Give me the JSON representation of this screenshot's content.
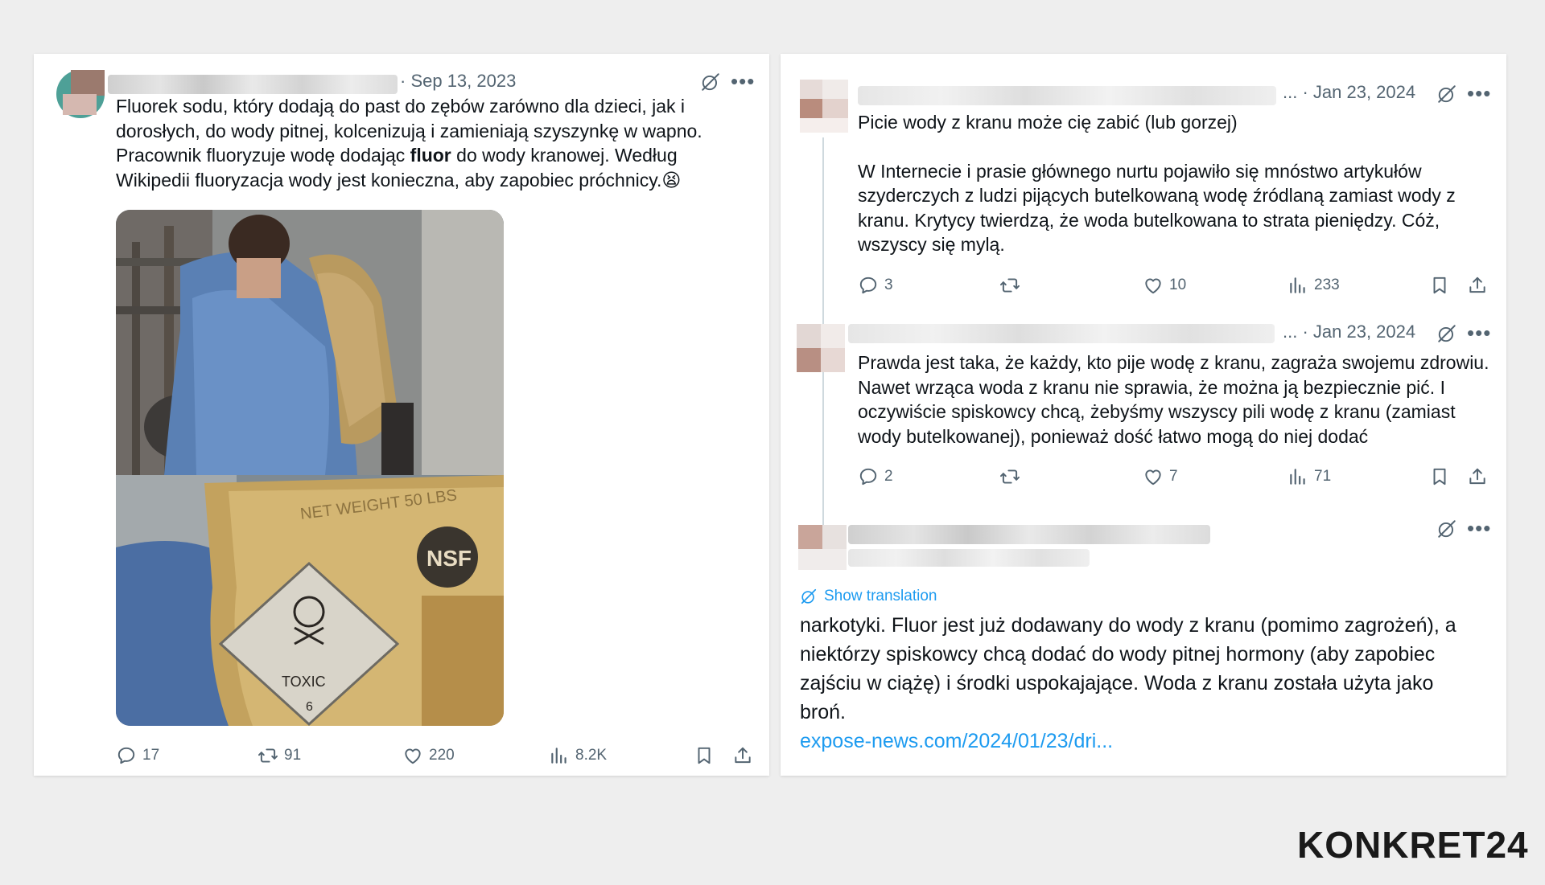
{
  "post1": {
    "date": "· Sep 13, 2023",
    "text_line1": "Fluorek sodu, który dodają do past do zębów zarówno dla dzieci, jak i",
    "text_line2": "dorosłych, do wody pitnej, kolcenizują i zamieniają szyszynkę w wapno.",
    "text_line3_a": "Pracownik fluoryzuje wodę dodając ",
    "text_line3_bold": "fluor",
    "text_line3_b": " do wody kranowej. Według",
    "text_line4": "Wikipedii fluoryzacja wody jest konieczna, aby zapobiec próchnicy.",
    "text_emoji": "😫",
    "media_text_weight": "NET WEIGHT 50 LBS",
    "media_text_nsf": "NSF",
    "media_text_toxic": "TOXIC",
    "media_text_toxic_num": "6",
    "replies": "17",
    "reposts": "91",
    "likes": "220",
    "views": "8.2K"
  },
  "post2": {
    "date": "... · Jan 23, 2024",
    "title": "Picie wody z kranu może cię zabić (lub gorzej)",
    "body_line1": "W Internecie i prasie głównego nurtu pojawiło się mnóstwo artykułów",
    "body_line2": "szyderczych z ludzi pijących butelkowaną wodę źródlaną zamiast wody z",
    "body_line3": "kranu. Krytycy twierdzą, że woda butelkowana to strata pieniędzy. Cóż,",
    "body_line4": "wszyscy się mylą.",
    "replies": "3",
    "likes": "10",
    "views": "233"
  },
  "post3": {
    "date": "... · Jan 23, 2024",
    "body_line1": "Prawda jest taka, że każdy, kto pije wodę z kranu, zagraża swojemu zdrowiu.",
    "body_line2": "Nawet wrząca woda z kranu nie sprawia, że można ją bezpiecznie pić. I",
    "body_line3": "oczywiście spiskowcy chcą, żebyśmy wszyscy pili wodę z kranu (zamiast",
    "body_line4": "wody butelkowanej), ponieważ dość łatwo mogą do niej dodać",
    "replies": "2",
    "likes": "7",
    "views": "71"
  },
  "post4": {
    "show_translation": "Show translation",
    "body_line1": "narkotyki. Fluor jest już dodawany do wody z kranu (pomimo zagrożeń), a",
    "body_line2": "niektórzy spiskowcy chcą dodać do wody pitnej hormony (aby zapobiec",
    "body_line3": "zajściu w ciążę) i środki uspokajające. Woda z kranu została użyta jako",
    "body_line4": "broń.",
    "link": "expose-news.com/2024/01/23/dri..."
  },
  "brand": "KONKRET24",
  "icons": {
    "reply": "reply-icon",
    "repost": "repost-icon",
    "like": "heart-icon",
    "views": "views-icon",
    "bookmark": "bookmark-icon",
    "share": "share-icon",
    "grok": "grok-icon",
    "more": "more-icon",
    "translate": "translate-icon"
  },
  "colors": {
    "accent_link": "#1d9bf0",
    "muted_text": "#536471",
    "background": "#eeeeee"
  }
}
